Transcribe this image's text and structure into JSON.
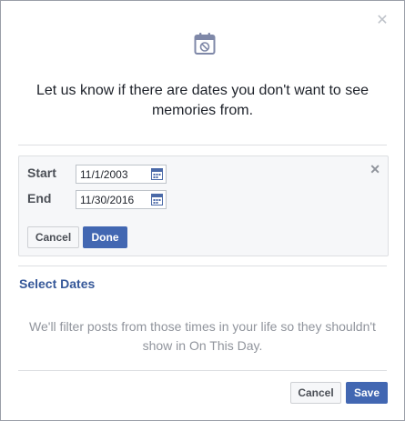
{
  "dialog": {
    "close_icon": "close-icon",
    "hero_icon": "calendar-icon",
    "headline": "Let us know if there are dates you don't want to see memories from."
  },
  "date_range": {
    "start_label": "Start",
    "start_value": "11/1/2003",
    "end_label": "End",
    "end_value": "11/30/2016",
    "cancel_label": "Cancel",
    "done_label": "Done"
  },
  "select_dates": {
    "title": "Select Dates",
    "info": "We'll filter posts from those times in your life so they shouldn't show in On This Day."
  },
  "footer": {
    "cancel_label": "Cancel",
    "save_label": "Save"
  },
  "colors": {
    "accent": "#4267b2",
    "link": "#365899",
    "muted": "#90949c"
  }
}
